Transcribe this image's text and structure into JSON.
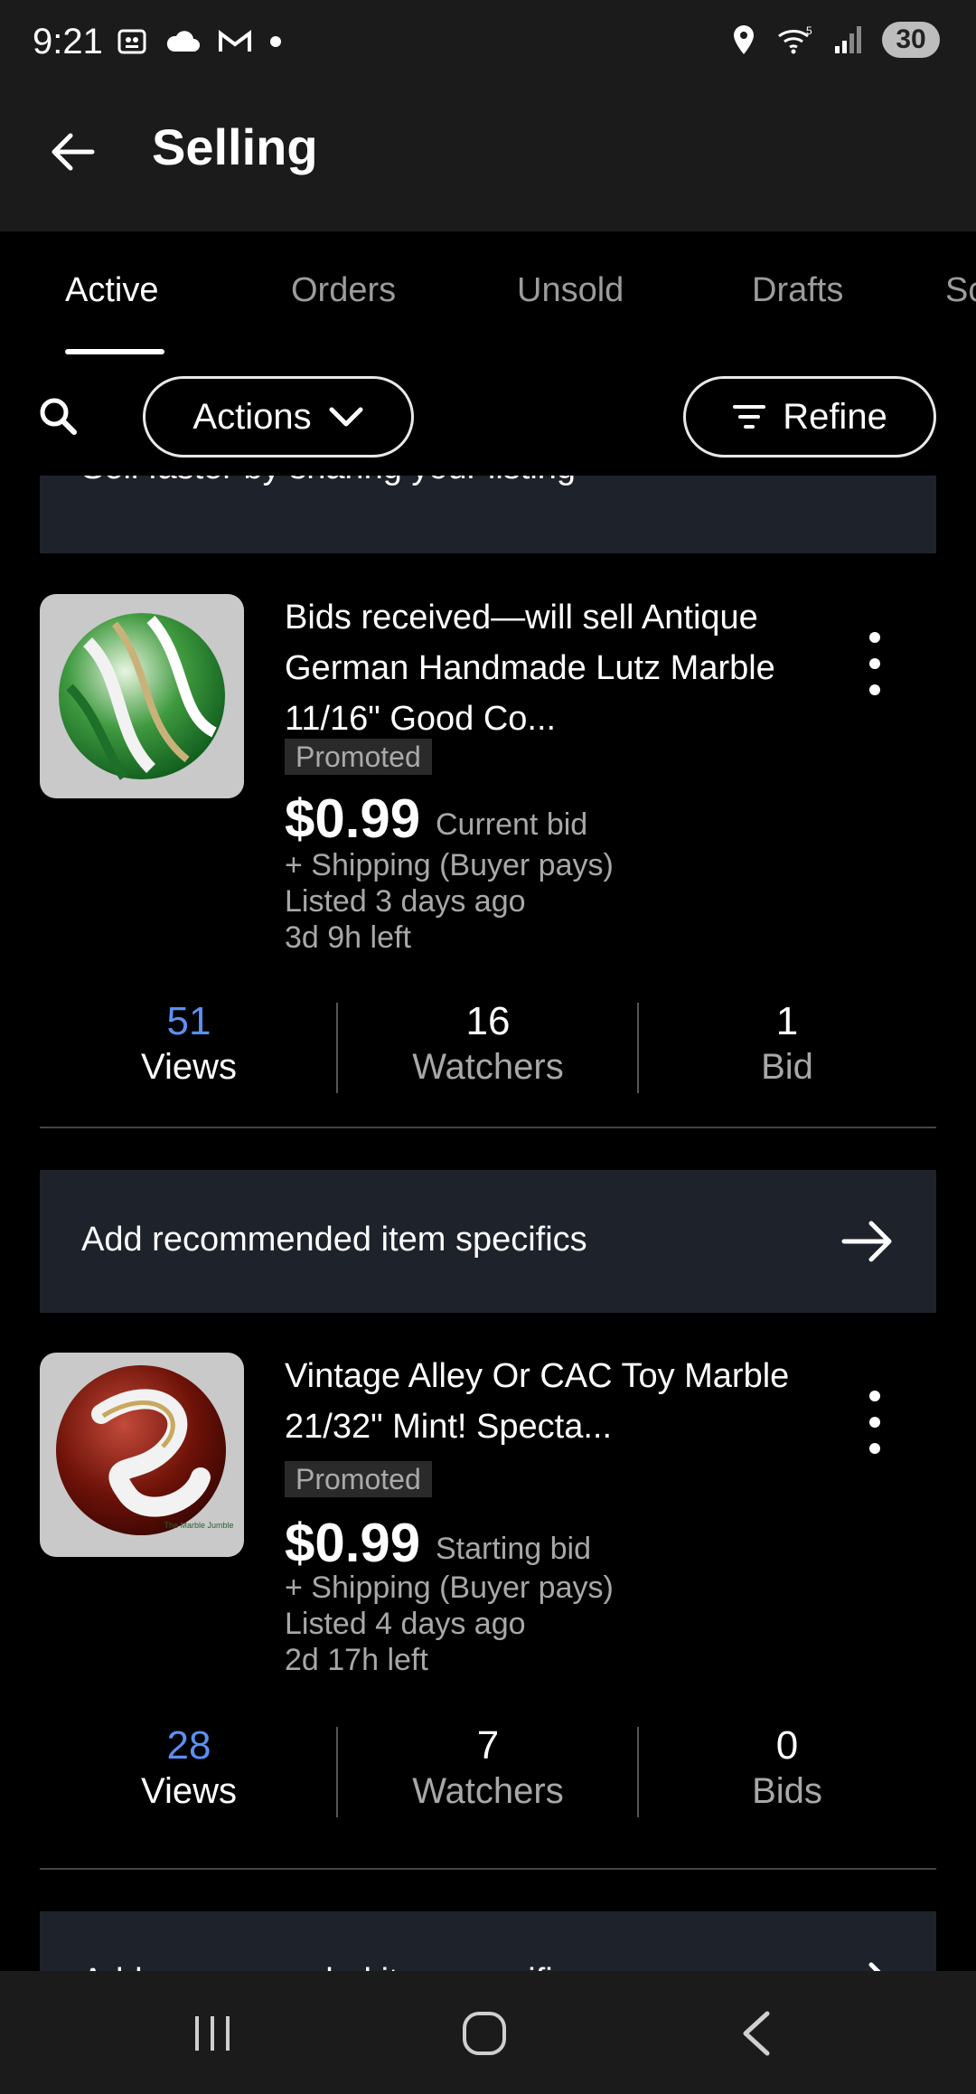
{
  "status_bar": {
    "time": "9:21",
    "battery": "30",
    "icons": [
      "screenshot-icon",
      "cloud-icon",
      "gmail-icon",
      "dot-icon",
      "location-icon",
      "wifi-icon",
      "signal-icon"
    ]
  },
  "app_bar": {
    "title": "Selling"
  },
  "tabs": [
    {
      "label": "Active",
      "active": true
    },
    {
      "label": "Orders",
      "active": false
    },
    {
      "label": "Unsold",
      "active": false
    },
    {
      "label": "Drafts",
      "active": false
    },
    {
      "label": "Sc",
      "active": false
    }
  ],
  "filters": {
    "actions_label": "Actions",
    "refine_label": "Refine"
  },
  "top_banner": {
    "text": "Sell faster by sharing your listing"
  },
  "listings": [
    {
      "title": "Bids received—will sell Antique German Handmade Lutz Marble 11/16\" Good Co...",
      "badge": "Promoted",
      "price": "$0.99",
      "price_note": "Current bid",
      "shipping": "+ Shipping (Buyer pays)",
      "listed": "Listed 3 days ago",
      "time_left": "3d 9h left",
      "stats": {
        "views_value": "51",
        "views_label": "Views",
        "watchers_value": "16",
        "watchers_label": "Watchers",
        "bids_value": "1",
        "bids_label": "Bid"
      },
      "banner": "Add recommended item specifics"
    },
    {
      "title": "Vintage Alley Or CAC Toy Marble 21/32\" Mint! Specta...",
      "badge": "Promoted",
      "price": "$0.99",
      "price_note": "Starting bid",
      "shipping": "+ Shipping (Buyer pays)",
      "listed": "Listed 4 days ago",
      "time_left": "2d 17h left",
      "image_caption": "The Marble Jumble",
      "stats": {
        "views_value": "28",
        "views_label": "Views",
        "watchers_value": "7",
        "watchers_label": "Watchers",
        "bids_value": "0",
        "bids_label": "Bids"
      },
      "banner": "Add recommended item specifics"
    }
  ],
  "colors": {
    "background": "#000000",
    "bar": "#1b1b1b",
    "banner": "#1e222a",
    "views_accent": "#5c8ff0"
  }
}
